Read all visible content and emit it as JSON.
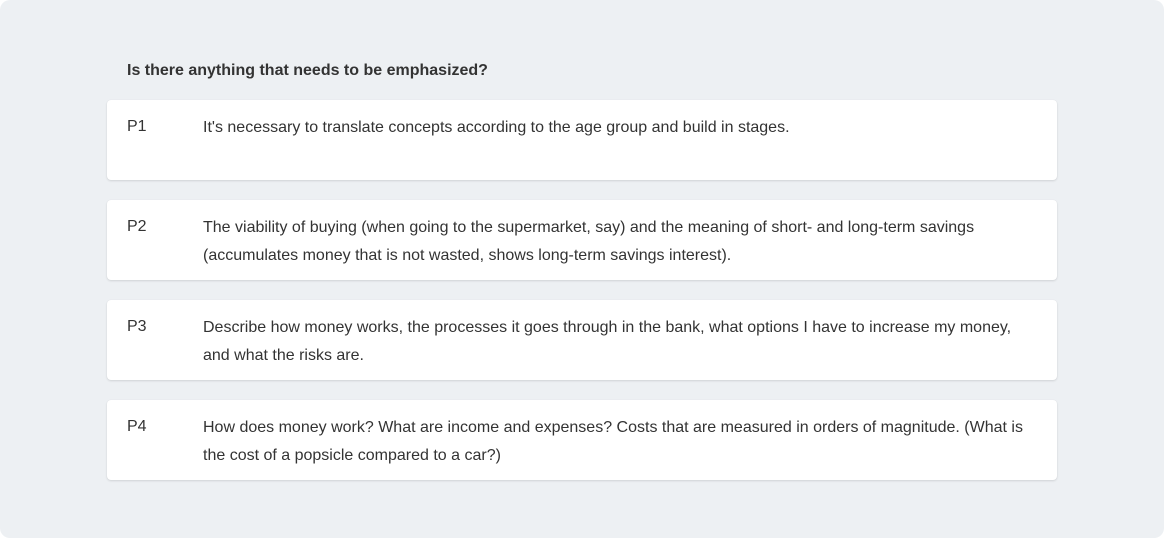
{
  "question": "Is there anything that needs to be emphasized?",
  "responses": [
    {
      "id": "P1",
      "text": "It's necessary to translate concepts according to the age group and build in stages."
    },
    {
      "id": "P2",
      "text": "The viability of buying (when going to the supermarket, say) and the meaning of short- and long-term savings (accumulates money that is not wasted, shows long-term savings interest)."
    },
    {
      "id": "P3",
      "text": "Describe how money works, the processes it goes through in the bank, what options I have to increase my money, and what the risks are."
    },
    {
      "id": "P4",
      "text": "How does money work? What are income and expenses? Costs that are measured in orders of magnitude. (What is the cost of a popsicle compared to a car?)"
    }
  ]
}
